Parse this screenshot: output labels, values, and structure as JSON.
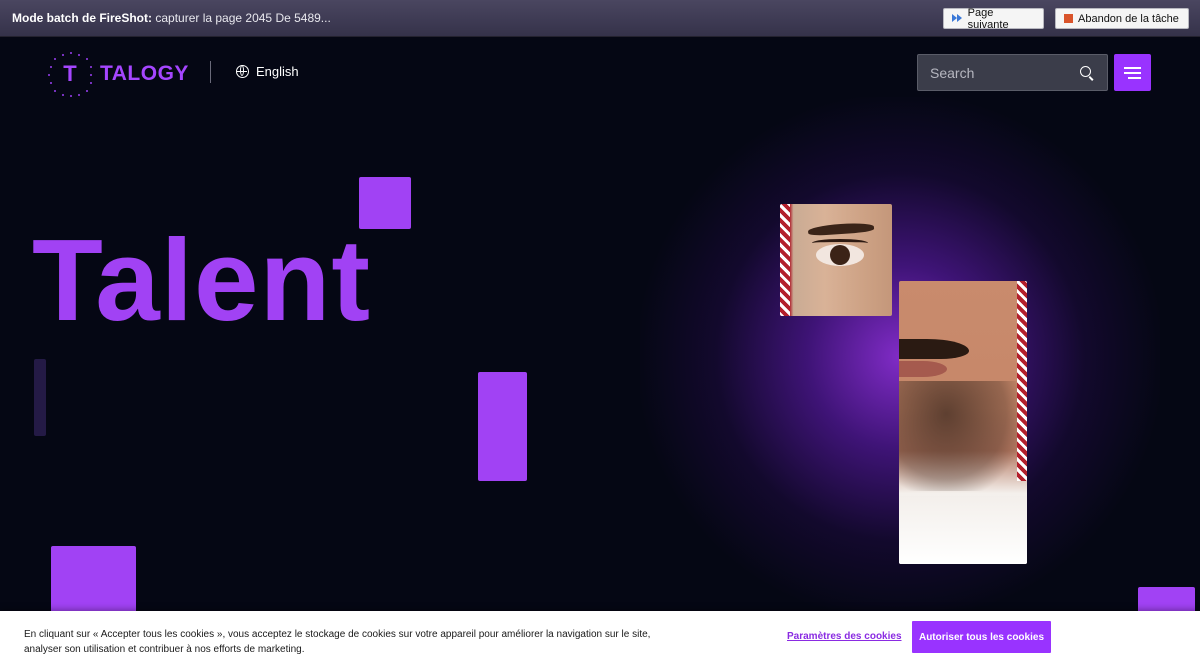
{
  "fireshot": {
    "title_bold": "Mode batch de FireShot:",
    "title_rest": " capturer la page 2045 De 5489...",
    "next_label": "Page suivante",
    "abort_label": "Abandon de la tâche"
  },
  "header": {
    "logo_letter": "T",
    "logo_text": "TALOGY",
    "language": "English",
    "search_placeholder": "Search"
  },
  "hero": {
    "title": "Talent"
  },
  "cookie": {
    "text": "En cliquant sur « Accepter tous les cookies », vous acceptez le stockage de cookies sur votre appareil pour améliorer la navigation sur le site, analyser son utilisation et contribuer à nos efforts de marketing.",
    "settings_label": "Paramètres des cookies",
    "accept_label": "Autoriser tous les cookies"
  },
  "colors": {
    "brand_purple": "#a142f4",
    "button_purple": "#9933ff",
    "background": "#050714"
  },
  "icons": [
    "fast-forward-icon",
    "stop-icon",
    "globe-icon",
    "search-icon",
    "hamburger-menu-icon"
  ]
}
